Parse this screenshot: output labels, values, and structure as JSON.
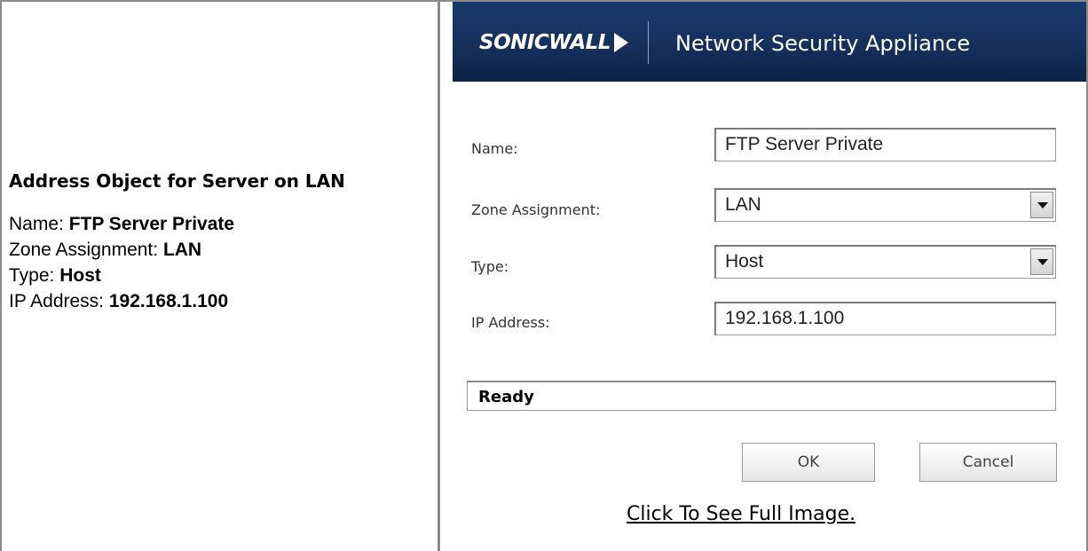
{
  "description": {
    "heading": "Address Object for Server on LAN",
    "lines": [
      {
        "label": "Name: ",
        "value": "FTP Server Private"
      },
      {
        "label": "Zone Assignment: ",
        "value": "LAN"
      },
      {
        "label": "Type: ",
        "value": "Host"
      },
      {
        "label": "IP Address: ",
        "value": "192.168.1.100"
      }
    ]
  },
  "header": {
    "logo": "SONICWALL",
    "title": "Network Security Appliance"
  },
  "form": {
    "name_label": "Name:",
    "name_value": "FTP Server Private",
    "zone_label": "Zone Assignment:",
    "zone_value": "LAN",
    "type_label": "Type:",
    "type_value": "Host",
    "ip_label": "IP Address:",
    "ip_value": "192.168.1.100"
  },
  "status": "Ready",
  "buttons": {
    "ok": "OK",
    "cancel": "Cancel"
  },
  "link": "Click To See Full Image."
}
